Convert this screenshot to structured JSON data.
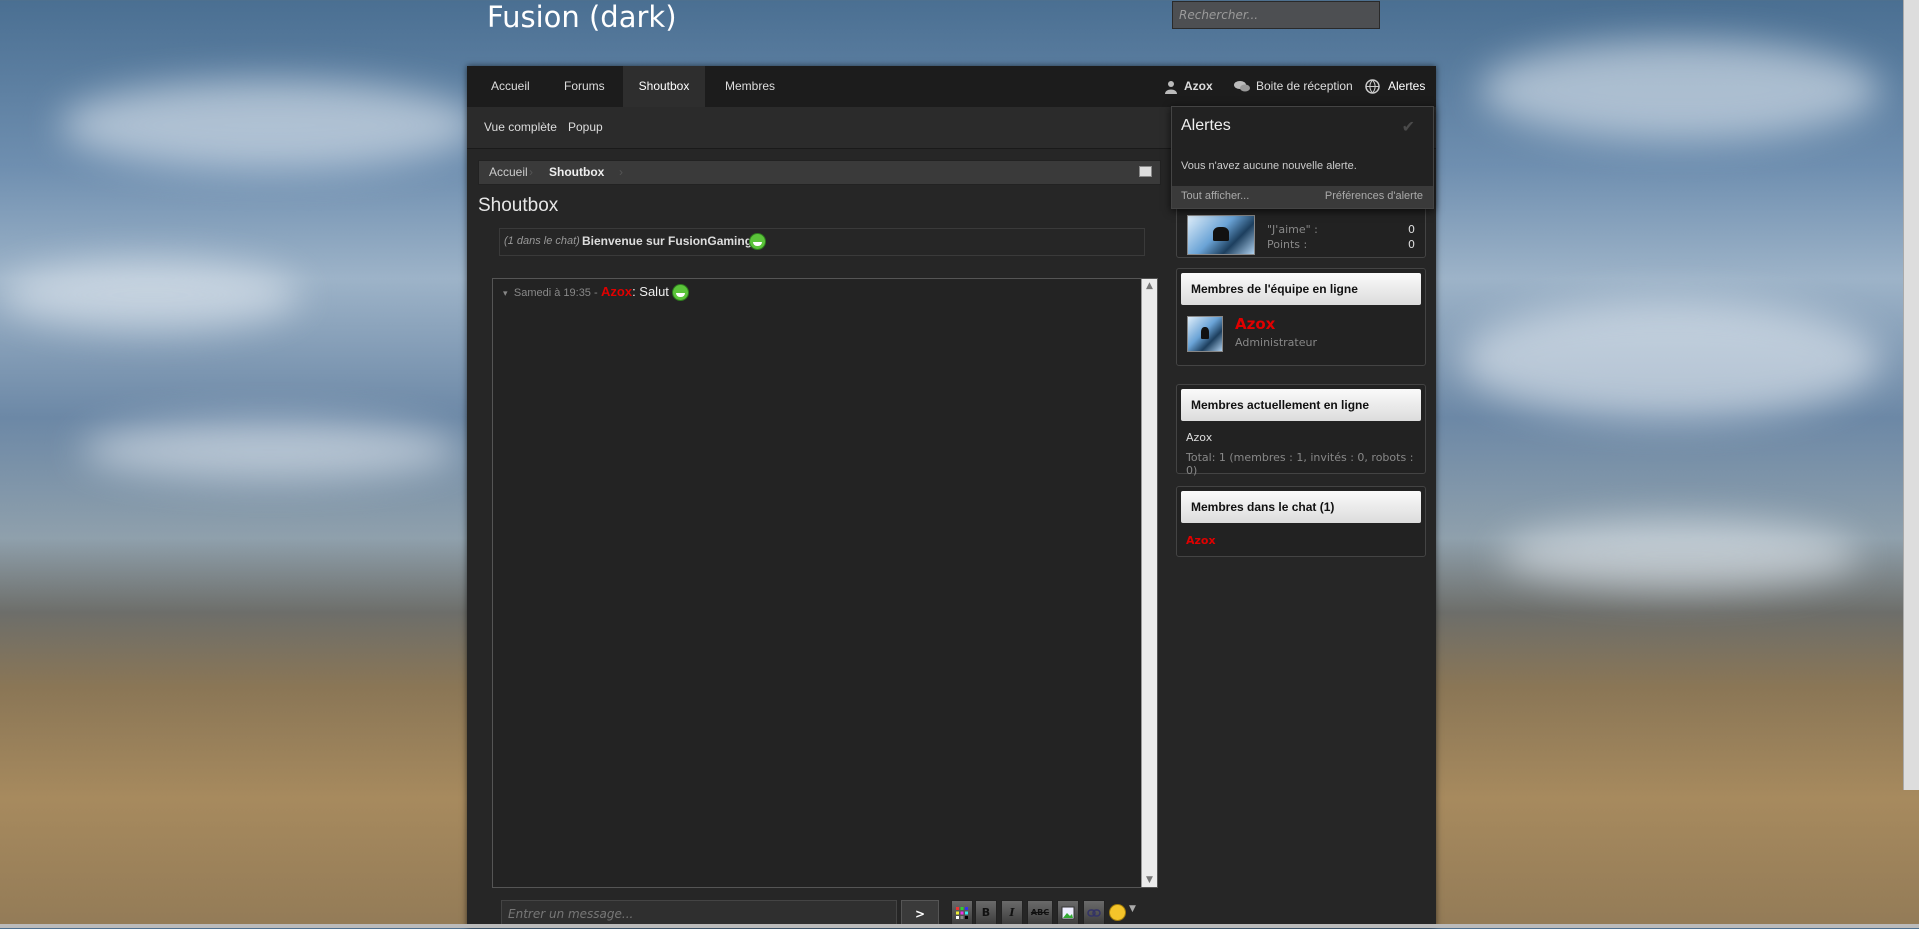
{
  "site": {
    "title": "Fusion (dark)",
    "search_placeholder": "Rechercher..."
  },
  "nav": {
    "tabs": [
      "Accueil",
      "Forums",
      "Shoutbox",
      "Membres"
    ],
    "active": "Shoutbox",
    "user": "Azox",
    "inbox": "Boite de réception",
    "alerts": "Alertes"
  },
  "subnav": {
    "items": [
      "Vue complète",
      "Popup"
    ]
  },
  "breadcrumb": {
    "items": [
      "Accueil",
      "Shoutbox"
    ]
  },
  "page": {
    "title": "Shoutbox",
    "welcome_prefix": "(1 dans le chat)",
    "welcome_text": "Bienvenue sur FusionGaming"
  },
  "chat": {
    "messages": [
      {
        "time": "Samedi à 19:35 -",
        "author": "Azox",
        "text": ": Salut"
      }
    ],
    "input_placeholder": "Entrer un message...",
    "send_label": ">",
    "toolbar": {
      "bold": "B",
      "italic": "I",
      "strike": "ABC"
    }
  },
  "alerts_popup": {
    "title": "Alertes",
    "empty_text": "Vous n'avez aucune nouvelle alerte.",
    "show_all": "Tout afficher...",
    "preferences": "Préférences d'alerte"
  },
  "profile_stats": [
    {
      "label": "\"J'aime\" :",
      "value": "0"
    },
    {
      "label": "Points :",
      "value": "0"
    }
  ],
  "staff_online": {
    "heading": "Membres de l'équipe en ligne",
    "name": "Azox",
    "role": "Administrateur"
  },
  "members_online": {
    "heading": "Membres actuellement en ligne",
    "name": "Azox",
    "total": "Total: 1 (membres : 1, invités : 0, robots : 0)"
  },
  "chat_members": {
    "heading": "Membres dans le chat (1)",
    "name": "Azox"
  },
  "colors": {
    "accent_red": "#e00000",
    "panel": "#262626",
    "nav": "#1c1c1c"
  }
}
